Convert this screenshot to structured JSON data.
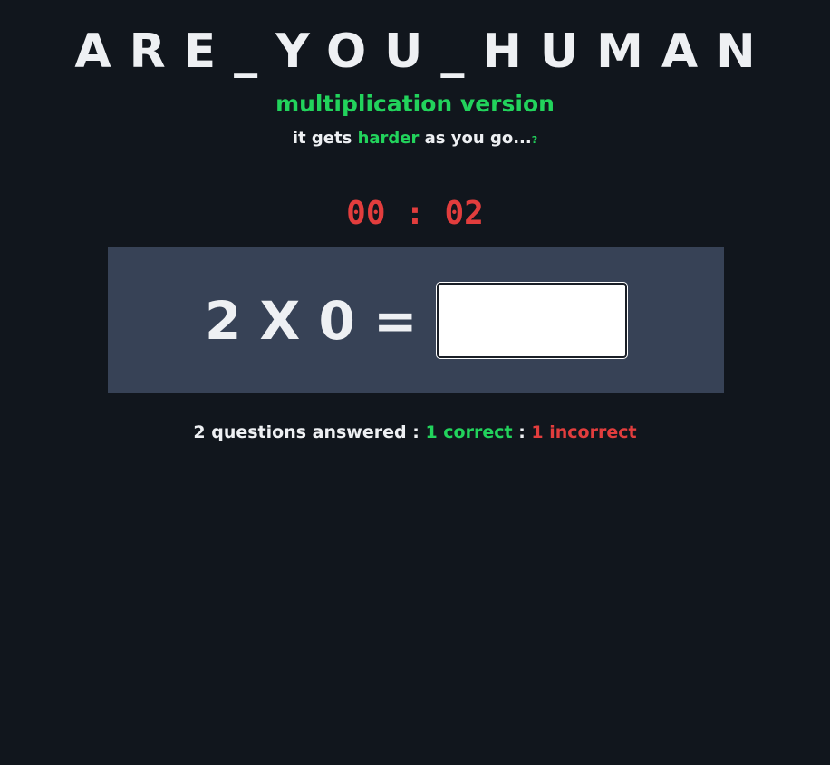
{
  "header": {
    "title": "ARE_YOU_HUMAN",
    "subtitle": "multiplication version",
    "tagline_pre": "it gets ",
    "tagline_accent": "harder",
    "tagline_post": " as you go...",
    "help_mark": "?"
  },
  "timer": {
    "display": "00 : 02"
  },
  "question": {
    "text": "2 X 0 =",
    "answer_value": "",
    "answer_placeholder": ""
  },
  "stats": {
    "answered": "2 questions answered :",
    "separator": ":",
    "correct": "1 correct",
    "incorrect": "1 incorrect"
  },
  "colors": {
    "background": "#11161d",
    "panel": "#374256",
    "accent_green": "#22d35c",
    "accent_red": "#e23d3d",
    "text": "#eef0f3"
  }
}
